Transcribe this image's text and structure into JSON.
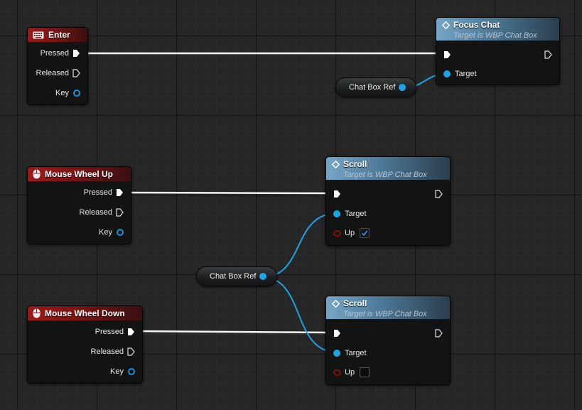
{
  "colors": {
    "event_header": "#a01818",
    "function_header": "#4d7896",
    "exec_wire": "#ffffff",
    "object_wire": "#1ca3e8",
    "bool_pin": "#8a0b0b"
  },
  "event_nodes": {
    "enter": {
      "title": "Enter",
      "icon": "keyboard-icon",
      "pins": {
        "pressed": "Pressed",
        "released": "Released",
        "key": "Key"
      }
    },
    "wheel_up": {
      "title": "Mouse Wheel Up",
      "icon": "mouse-icon",
      "pins": {
        "pressed": "Pressed",
        "released": "Released",
        "key": "Key"
      }
    },
    "wheel_down": {
      "title": "Mouse Wheel Down",
      "icon": "mouse-icon",
      "pins": {
        "pressed": "Pressed",
        "released": "Released",
        "key": "Key"
      }
    }
  },
  "function_nodes": {
    "focus_chat": {
      "title": "Focus Chat",
      "subtitle": "Target is WBP Chat Box",
      "icon": "function-icon",
      "pins": {
        "target": "Target"
      }
    },
    "scroll_up": {
      "title": "Scroll",
      "subtitle": "Target is WBP Chat Box",
      "icon": "function-icon",
      "pins": {
        "target": "Target",
        "up": "Up"
      },
      "up_checked": true
    },
    "scroll_down": {
      "title": "Scroll",
      "subtitle": "Target is WBP Chat Box",
      "icon": "function-icon",
      "pins": {
        "target": "Target",
        "up": "Up"
      },
      "up_checked": false
    }
  },
  "variable_nodes": {
    "chat_box_ref_1": {
      "label": "Chat Box Ref"
    },
    "chat_box_ref_2": {
      "label": "Chat Box Ref"
    }
  }
}
